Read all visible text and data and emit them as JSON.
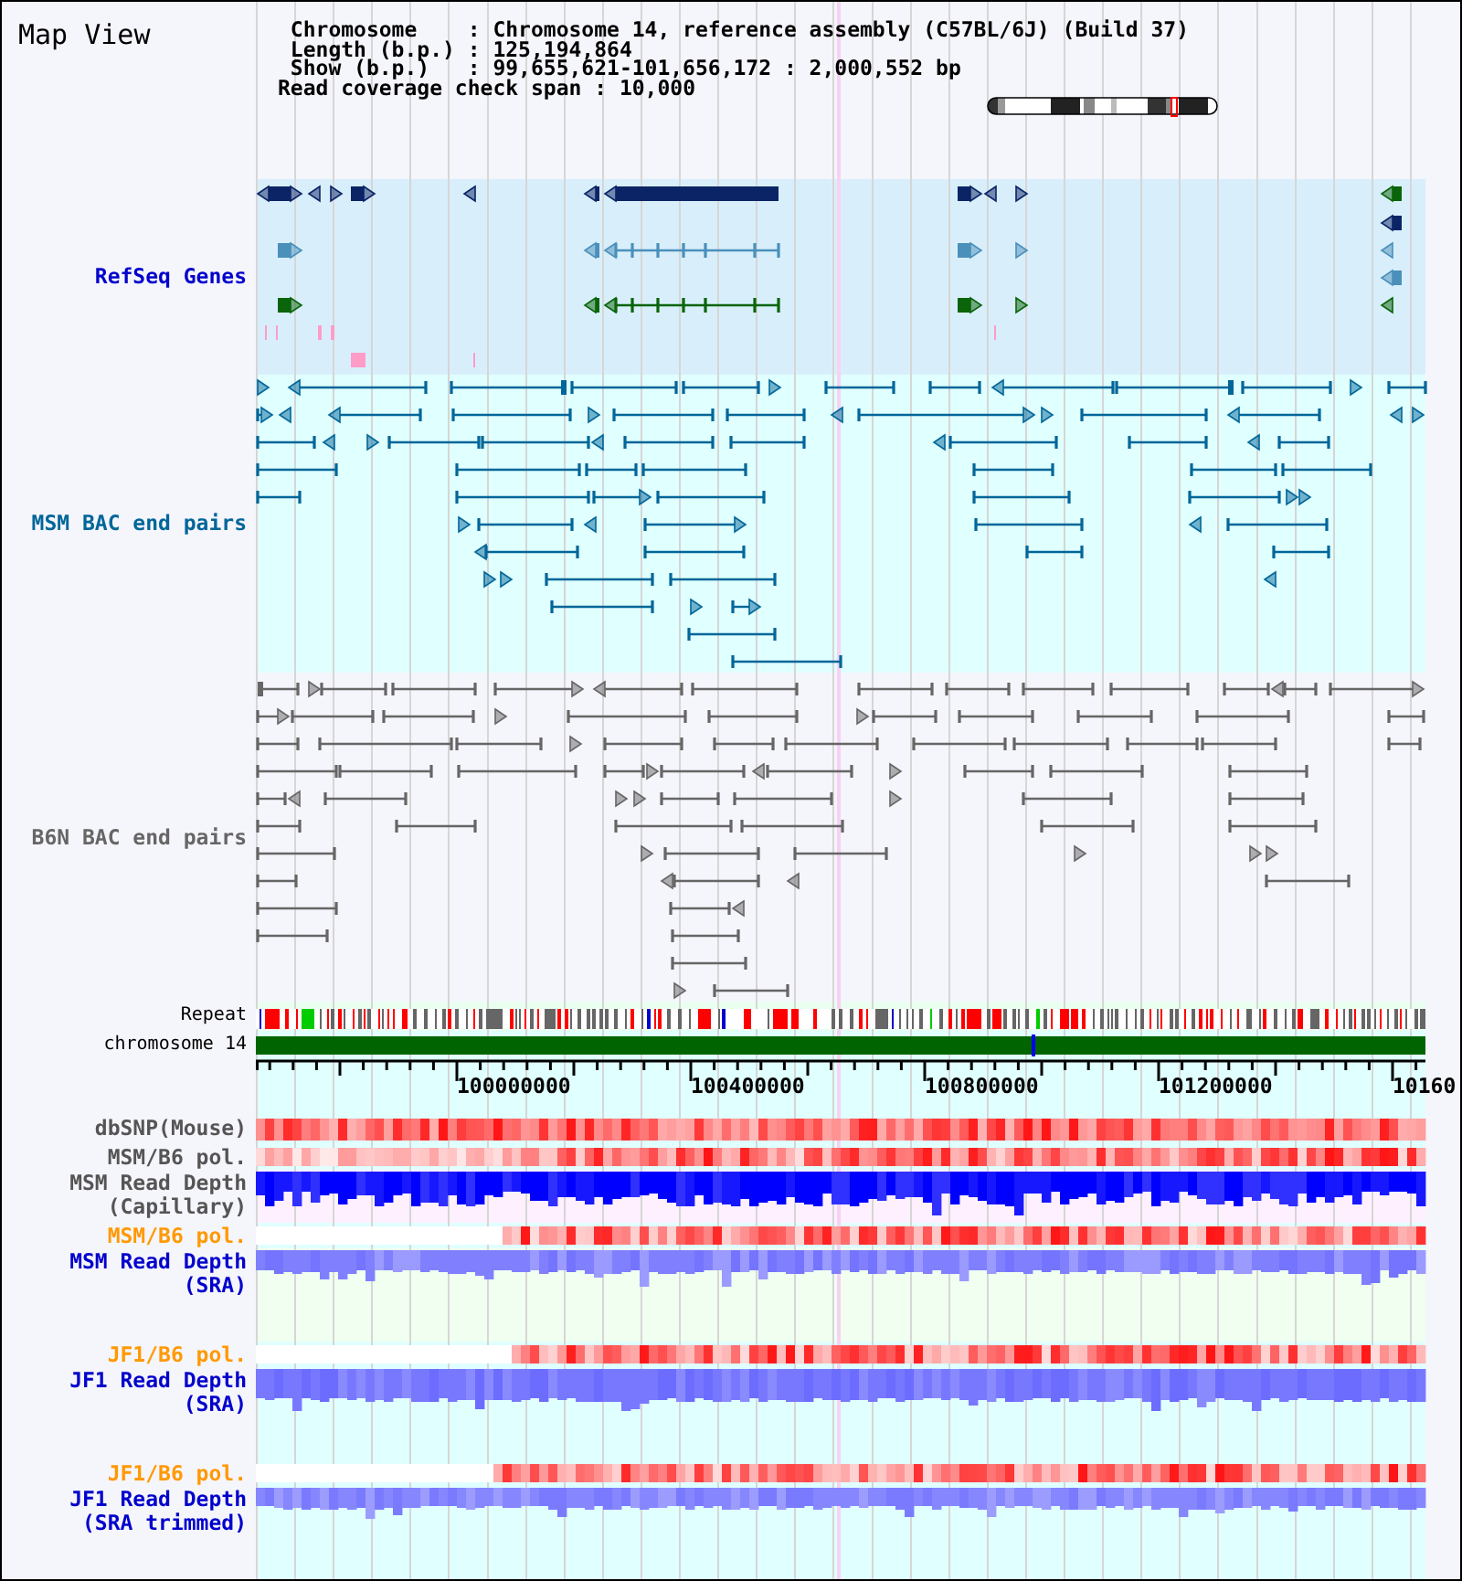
{
  "header": {
    "title": "Map View",
    "rows": [
      {
        "label": "Chromosome",
        "separator": ":",
        "value": "Chromosome 14, reference assembly (C57BL/6J) (Build 37)"
      },
      {
        "label": "Length (b.p.)",
        "separator": ":",
        "value": "125,194,864"
      },
      {
        "label": "Show (b.p.)",
        "separator": ":",
        "value": "99,655,621-101,656,172 : 2,000,552 bp"
      }
    ],
    "coverage": {
      "label": "Read coverage check span",
      "separator": ":",
      "value": "10,000"
    }
  },
  "tracks": [
    {
      "kind": "genes",
      "label": "RefSeq Genes",
      "color": "#0000cc"
    },
    {
      "kind": "bac",
      "label": "MSM BAC end pairs",
      "color": "#006699"
    },
    {
      "kind": "bac",
      "label": "B6N BAC end pairs",
      "color": "#666666"
    }
  ],
  "repeat_track": {
    "label": "Repeat"
  },
  "chromosome_track": {
    "label": "chromosome 14"
  },
  "ruler": {
    "labels": [
      "100000000",
      "100400000",
      "100800000",
      "101200000",
      "10160"
    ]
  },
  "data_tracks": [
    {
      "kind": "snp",
      "label": "dbSNP(Mouse)",
      "color": "#555555"
    },
    {
      "kind": "pol",
      "label": "MSM/B6 pol.",
      "color": "#555555"
    },
    {
      "kind": "capillary",
      "label": "MSM Read Depth (Capillary)",
      "color": "#555555"
    },
    {
      "kind": "pol",
      "label": "MSM/B6 pol.",
      "color": "#ff9900"
    },
    {
      "kind": "sra",
      "label": "MSM Read Depth (SRA)",
      "color": "#0000cc"
    },
    {
      "kind": "pol",
      "label": "JF1/B6 pol.",
      "color": "#ff9900"
    },
    {
      "kind": "sra",
      "label": "JF1 Read Depth (SRA)",
      "color": "#0000cc"
    },
    {
      "kind": "pol",
      "label": "JF1/B6 pol.",
      "color": "#ff9900"
    },
    {
      "kind": "sra",
      "label": "JF1 Read Depth (SRA trimmed)",
      "color": "#0000cc"
    }
  ]
}
